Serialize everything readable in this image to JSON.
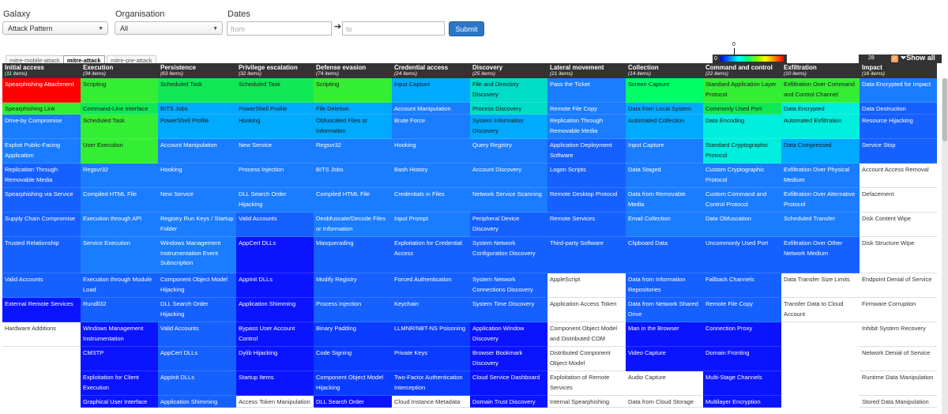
{
  "filters": {
    "galaxy_label": "Galaxy",
    "galaxy_value": "Attack Pattern",
    "org_label": "Organisation",
    "org_value": "All",
    "dates_label": "Dates",
    "from_placeholder": "from",
    "to_placeholder": "to",
    "arrow": "➔",
    "submit_label": "Submit"
  },
  "tabs": [
    {
      "label": "mitre-mobile-attack",
      "active": false
    },
    {
      "label": "mitre-attack",
      "active": true
    },
    {
      "label": "mitre-pre-attack",
      "active": false
    }
  ],
  "scale": {
    "min": "0",
    "max": "28",
    "top": "0",
    "show_all_label": "Show all",
    "filter_icon": "filter-icon"
  },
  "colors": {
    "red": "#ff0000",
    "green": "#00ff66",
    "lime": "#33ee33",
    "lgreen": "#11e855",
    "cyan": "#00eedd",
    "teal": "#00dcc8",
    "sky": "#00aaff",
    "blue1": "#1a7cff",
    "blue2": "#1560ff",
    "blue3": "#0a3cff",
    "blue4": "#0a14ff",
    "blue5": "#0000ff",
    "white": "#ffffff"
  },
  "columns": [
    {
      "title": "Initial access",
      "count": "(11 items)",
      "cells": [
        [
          "Spearphishing Attachment",
          "red",
          2
        ],
        [
          "Spearphishing Link",
          "lime",
          1
        ],
        [
          "Drive-by Compromise",
          "blue1",
          2
        ],
        [
          "Exploit Public-Facing Application",
          "blue1",
          2
        ],
        [
          "Replication Through Removable Media",
          "blue2",
          2
        ],
        [
          "Spearphishing via Service",
          "blue2",
          2
        ],
        [
          "Supply Chain Compromise",
          "blue2",
          2
        ],
        [
          "Trusted Relationship",
          "blue2",
          3
        ],
        [
          "Valid Accounts",
          "blue2",
          2
        ],
        [
          "External Remote Services",
          "blue4",
          2
        ],
        [
          "Hardware Additions",
          "white",
          2
        ]
      ]
    },
    {
      "title": "Execution",
      "count": "(34 items)",
      "cells": [
        [
          "Scripting",
          "lime",
          2
        ],
        [
          "Command-Line Interface",
          "lgreen",
          1
        ],
        [
          "Scheduled Task",
          "lime",
          2
        ],
        [
          "User Execution",
          "lime",
          2
        ],
        [
          "Regsvr32",
          "blue1",
          2
        ],
        [
          "Compiled HTML File",
          "blue1",
          2
        ],
        [
          "Execution through API",
          "blue1",
          2
        ],
        [
          "Service Execution",
          "blue1",
          3
        ],
        [
          "Execution through Module Load",
          "blue2",
          2
        ],
        [
          "Rundll32",
          "blue2",
          2
        ],
        [
          "Windows Management Instrumentation",
          "blue4",
          2
        ],
        [
          "CMSTP",
          "blue4",
          2
        ],
        [
          "Exploitation for Client Execution",
          "blue4",
          2
        ],
        [
          "Graphical User Interface",
          "blue4",
          1
        ]
      ]
    },
    {
      "title": "Persistence",
      "count": "(63 items)",
      "cells": [
        [
          "Scheduled Task",
          "lgreen",
          2
        ],
        [
          "BITS Jobs",
          "sky",
          1
        ],
        [
          "PowerShell Profile",
          "sky",
          2
        ],
        [
          "Account Manipulation",
          "blue1",
          2
        ],
        [
          "Hooking",
          "blue1",
          2
        ],
        [
          "New Service",
          "blue1",
          2
        ],
        [
          "Registry Run Keys / Startup Folder",
          "blue1",
          2
        ],
        [
          "Windows Management Instrumentation Event Subscription",
          "blue1",
          3
        ],
        [
          "Component Object Model Hijacking",
          "blue2",
          2
        ],
        [
          "DLL Search Order Hijacking",
          "blue2",
          2
        ],
        [
          "Valid Accounts",
          "blue2",
          2
        ],
        [
          "AppCert DLLs",
          "blue2",
          2
        ],
        [
          "AppInit DLLs",
          "blue2",
          2
        ],
        [
          "Application Shimming",
          "blue2",
          1
        ]
      ]
    },
    {
      "title": "Privilege escalation",
      "count": "(32 items)",
      "cells": [
        [
          "Scheduled Task",
          "lgreen",
          2
        ],
        [
          "PowerShell Profile",
          "sky",
          1
        ],
        [
          "Hooking",
          "sky",
          2
        ],
        [
          "New Service",
          "blue1",
          2
        ],
        [
          "Process Injection",
          "blue1",
          2
        ],
        [
          "DLL Search Order Hijacking",
          "blue1",
          2
        ],
        [
          "Valid Accounts",
          "blue2",
          2
        ],
        [
          "AppCert DLLs",
          "blue4",
          3
        ],
        [
          "AppInit DLLs",
          "blue4",
          2
        ],
        [
          "Application Shimming",
          "blue4",
          2
        ],
        [
          "Bypass User Account Control",
          "blue4",
          2
        ],
        [
          "Dylib Hijacking",
          "blue4",
          2
        ],
        [
          "Startup Items",
          "blue4",
          2
        ],
        [
          "Access Token Manipulation",
          "white",
          1
        ]
      ]
    },
    {
      "title": "Defense evasion",
      "count": "(74 items)",
      "cells": [
        [
          "Scripting",
          "lime",
          2
        ],
        [
          "File Deletion",
          "sky",
          1
        ],
        [
          "Obfuscated Files or Information",
          "sky",
          2
        ],
        [
          "Regsvr32",
          "blue1",
          2
        ],
        [
          "BITS Jobs",
          "blue1",
          2
        ],
        [
          "Compiled HTML File",
          "blue1",
          2
        ],
        [
          "Deobfuscate/Decode Files or Information",
          "blue1",
          2
        ],
        [
          "Masquerading",
          "blue2",
          3
        ],
        [
          "Modify Registry",
          "blue2",
          2
        ],
        [
          "Process Injection",
          "blue2",
          2
        ],
        [
          "Binary Padding",
          "blue3",
          2
        ],
        [
          "Code Signing",
          "blue3",
          2
        ],
        [
          "Component Object Model Hijacking",
          "blue3",
          2
        ],
        [
          "DLL Search Order",
          "blue4",
          1
        ]
      ]
    },
    {
      "title": "Credential access",
      "count": "(24 items)",
      "cells": [
        [
          "Input Capture",
          "sky",
          2
        ],
        [
          "Account Manipulation",
          "blue1",
          1
        ],
        [
          "Brute Force",
          "blue1",
          2
        ],
        [
          "Hooking",
          "blue1",
          2
        ],
        [
          "Bash History",
          "blue1",
          2
        ],
        [
          "Credentials in Files",
          "blue1",
          2
        ],
        [
          "Input Prompt",
          "blue1",
          2
        ],
        [
          "Exploitation for Credential Access",
          "blue2",
          3
        ],
        [
          "Forced Authentication",
          "blue2",
          2
        ],
        [
          "Keychain",
          "blue2",
          2
        ],
        [
          "LLMNR/NBT-NS Poisoning",
          "blue3",
          2
        ],
        [
          "Private Keys",
          "blue3",
          2
        ],
        [
          "Two-Factor Authentication Interception",
          "blue3",
          2
        ],
        [
          "Cloud Instance Metadata",
          "white",
          1
        ]
      ]
    },
    {
      "title": "Discovery",
      "count": "(25 items)",
      "cells": [
        [
          "File and Directory Discovery",
          "teal",
          2
        ],
        [
          "Process Discovery",
          "teal",
          1
        ],
        [
          "System Information Discovery",
          "sky",
          2
        ],
        [
          "Query Registry",
          "blue1",
          2
        ],
        [
          "Account Discovery",
          "blue1",
          2
        ],
        [
          "Network Service Scanning",
          "blue1",
          2
        ],
        [
          "Peripheral Device Discovery",
          "blue2",
          2
        ],
        [
          "System Network Configuration Discovery",
          "blue2",
          3
        ],
        [
          "System Network Connections Discovery",
          "blue2",
          2
        ],
        [
          "System Time Discovery",
          "blue2",
          2
        ],
        [
          "Application Window Discovery",
          "blue4",
          2
        ],
        [
          "Browser Bookmark Discovery",
          "blue4",
          2
        ],
        [
          "Cloud Service Dashboard",
          "blue4",
          2
        ],
        [
          "Domain Trust Discovery",
          "blue4",
          1
        ]
      ]
    },
    {
      "title": "Lateral movement",
      "count": "(21 items)",
      "cells": [
        [
          "Pass the Ticket",
          "blue1",
          2
        ],
        [
          "Remote File Copy",
          "blue1",
          1
        ],
        [
          "Replication Through Removable Media",
          "blue1",
          2
        ],
        [
          "Application Deployment Software",
          "blue2",
          2
        ],
        [
          "Logon Scripts",
          "blue2",
          2
        ],
        [
          "Remote Desktop Protocol",
          "blue2",
          2
        ],
        [
          "Remote Services",
          "blue2",
          2
        ],
        [
          "Third-party Software",
          "blue2",
          3
        ],
        [
          "AppleScript",
          "white",
          2
        ],
        [
          "Application Access Token",
          "white",
          2
        ],
        [
          "Component Object Model and Distributed COM",
          "white",
          2
        ],
        [
          "Distributed Component Object Model",
          "white",
          2
        ],
        [
          "Exploitation of Remote Services",
          "white",
          2
        ],
        [
          "Internal Spearphishing",
          "white",
          1
        ]
      ]
    },
    {
      "title": "Collection",
      "count": "(14 items)",
      "cells": [
        [
          "Screen Capture",
          "green",
          2
        ],
        [
          "Data from Local System",
          "sky",
          1
        ],
        [
          "Automated Collection",
          "sky",
          2
        ],
        [
          "Input Capture",
          "blue1",
          2
        ],
        [
          "Data Staged",
          "blue1",
          2
        ],
        [
          "Data from Removable Media",
          "blue1",
          2
        ],
        [
          "Email Collection",
          "blue1",
          2
        ],
        [
          "Clipboard Data",
          "blue2",
          3
        ],
        [
          "Data from Information Repositories",
          "blue2",
          2
        ],
        [
          "Data from Network Shared Drive",
          "blue2",
          2
        ],
        [
          "Man in the Browser",
          "blue4",
          2
        ],
        [
          "Video Capture",
          "blue4",
          2
        ],
        [
          "Audio Capture",
          "white",
          2
        ],
        [
          "Data from Cloud Storage",
          "white",
          1
        ]
      ]
    },
    {
      "title": "Command and control",
      "count": "(22 items)",
      "cells": [
        [
          "Standard Application Layer Protocol",
          "lime",
          2
        ],
        [
          "Commonly Used Port",
          "lgreen",
          1
        ],
        [
          "Data Encoding",
          "cyan",
          2
        ],
        [
          "Standard Cryptographic Protocol",
          "cyan",
          2
        ],
        [
          "Custom Cryptographic Protocol",
          "blue1",
          2
        ],
        [
          "Custom Command and Control Protocol",
          "blue1",
          2
        ],
        [
          "Data Obfuscation",
          "blue1",
          2
        ],
        [
          "Uncommonly Used Port",
          "blue2",
          3
        ],
        [
          "Fallback Channels",
          "blue2",
          2
        ],
        [
          "Remote File Copy",
          "blue2",
          2
        ],
        [
          "Connection Proxy",
          "blue4",
          2
        ],
        [
          "Domain Fronting",
          "blue4",
          2
        ],
        [
          "Multi-Stage Channels",
          "blue4",
          2
        ],
        [
          "Multilayer Encryption",
          "blue4",
          1
        ]
      ]
    },
    {
      "title": "Exfiltration",
      "count": "(10 items)",
      "cells": [
        [
          "Exfiltration Over Command and Control Channel",
          "lime",
          2
        ],
        [
          "Data Encrypted",
          "cyan",
          1
        ],
        [
          "Automated Exfiltration",
          "cyan",
          2
        ],
        [
          "Data Compressed",
          "sky",
          2
        ],
        [
          "Exfiltration Over Physical Medium",
          "blue1",
          2
        ],
        [
          "Exfiltration Over Alternative Protocol",
          "blue1",
          2
        ],
        [
          "Scheduled Transfer",
          "blue1",
          2
        ],
        [
          "Exfiltration Over Other Network Medium",
          "blue2",
          3
        ],
        [
          "Data Transfer Size Limits",
          "white",
          2
        ],
        [
          "Transfer Data to Cloud Account",
          "white",
          2
        ]
      ]
    },
    {
      "title": "Impact",
      "count": "(16 items)",
      "cells": [
        [
          "Data Encrypted for Impact",
          "blue1",
          2
        ],
        [
          "Data Destruction",
          "blue2",
          1
        ],
        [
          "Resource Hijacking",
          "blue2",
          2
        ],
        [
          "Service Stop",
          "blue2",
          2
        ],
        [
          "Account Access Removal",
          "white",
          2
        ],
        [
          "Defacement",
          "white",
          2
        ],
        [
          "Disk Content Wipe",
          "white",
          2
        ],
        [
          "Disk Structure Wipe",
          "white",
          3
        ],
        [
          "Endpoint Denial of Service",
          "white",
          2
        ],
        [
          "Firmware Corruption",
          "white",
          2
        ],
        [
          "Inhibit System Recovery",
          "white",
          2
        ],
        [
          "Network Denial of Service",
          "white",
          2
        ],
        [
          "Runtime Data Manipulation",
          "white",
          2
        ],
        [
          "Stored Data Manipulation",
          "white",
          1
        ]
      ]
    }
  ]
}
